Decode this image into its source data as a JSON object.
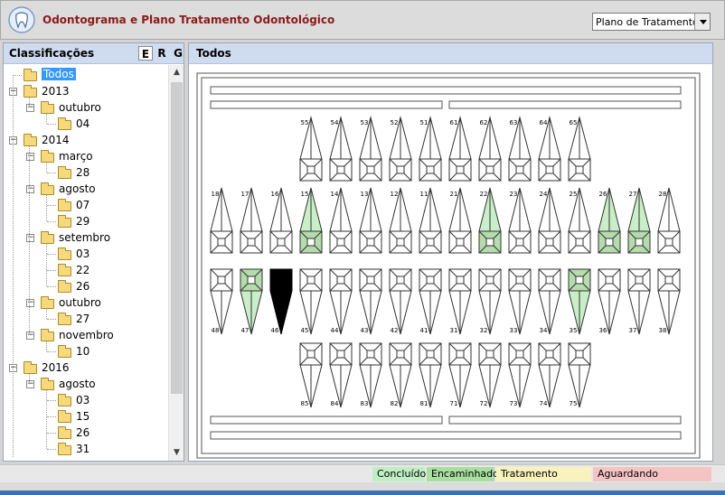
{
  "header": {
    "title": "Odontograma e Plano Tratamento Odontológico",
    "mode_select": {
      "value": "Plano de Tratamento"
    }
  },
  "left_panel": {
    "title": "Classificações",
    "buttons": [
      "E",
      "R",
      "G"
    ]
  },
  "tree": [
    {
      "label": "Todos",
      "level": 0,
      "selected": true,
      "expander": ""
    },
    {
      "label": "2013",
      "level": 0,
      "expander": "−"
    },
    {
      "label": "outubro",
      "level": 1,
      "expander": "−"
    },
    {
      "label": "04",
      "level": 2,
      "expander": ""
    },
    {
      "label": "2014",
      "level": 0,
      "expander": "−"
    },
    {
      "label": "março",
      "level": 1,
      "expander": "−"
    },
    {
      "label": "28",
      "level": 2,
      "expander": ""
    },
    {
      "label": "agosto",
      "level": 1,
      "expander": "−"
    },
    {
      "label": "07",
      "level": 2,
      "expander": ""
    },
    {
      "label": "29",
      "level": 2,
      "expander": ""
    },
    {
      "label": "setembro",
      "level": 1,
      "expander": "−"
    },
    {
      "label": "03",
      "level": 2,
      "expander": ""
    },
    {
      "label": "22",
      "level": 2,
      "expander": ""
    },
    {
      "label": "26",
      "level": 2,
      "expander": ""
    },
    {
      "label": "outubro",
      "level": 1,
      "expander": "−"
    },
    {
      "label": "27",
      "level": 2,
      "expander": ""
    },
    {
      "label": "novembro",
      "level": 1,
      "expander": "−"
    },
    {
      "label": "10",
      "level": 2,
      "expander": ""
    },
    {
      "label": "2016",
      "level": 0,
      "expander": "−"
    },
    {
      "label": "agosto",
      "level": 1,
      "expander": "−"
    },
    {
      "label": "03",
      "level": 2,
      "expander": ""
    },
    {
      "label": "15",
      "level": 2,
      "expander": ""
    },
    {
      "label": "26",
      "level": 2,
      "expander": ""
    },
    {
      "label": "31",
      "level": 2,
      "expander": ""
    }
  ],
  "right_panel": {
    "title": "Todos"
  },
  "colors": {
    "concluido": "#bfeec4",
    "encaminhado": "#a8dfa0",
    "interno": "#f8f3bc",
    "aguardando": "#f4c4c4",
    "root_green": "#c8efc8",
    "crown_green": "#b4dcac",
    "extracted": "#000000"
  },
  "odontogram": {
    "upper_primary": [
      {
        "n": "55",
        "state": "normal"
      },
      {
        "n": "54",
        "state": "normal"
      },
      {
        "n": "53",
        "state": "normal"
      },
      {
        "n": "52",
        "state": "normal"
      },
      {
        "n": "51",
        "state": "normal"
      },
      {
        "n": "61",
        "state": "normal"
      },
      {
        "n": "62",
        "state": "normal"
      },
      {
        "n": "63",
        "state": "normal"
      },
      {
        "n": "64",
        "state": "normal"
      },
      {
        "n": "65",
        "state": "normal"
      }
    ],
    "upper_permanent": [
      {
        "n": "18",
        "state": "normal"
      },
      {
        "n": "17",
        "state": "normal"
      },
      {
        "n": "16",
        "state": "normal"
      },
      {
        "n": "15",
        "state": "green"
      },
      {
        "n": "14",
        "state": "normal"
      },
      {
        "n": "13",
        "state": "normal"
      },
      {
        "n": "12",
        "state": "normal"
      },
      {
        "n": "11",
        "state": "normal"
      },
      {
        "n": "21",
        "state": "normal"
      },
      {
        "n": "22",
        "state": "green"
      },
      {
        "n": "23",
        "state": "normal"
      },
      {
        "n": "24",
        "state": "normal"
      },
      {
        "n": "25",
        "state": "normal"
      },
      {
        "n": "26",
        "state": "green"
      },
      {
        "n": "27",
        "state": "green"
      },
      {
        "n": "28",
        "state": "normal"
      }
    ],
    "lower_permanent": [
      {
        "n": "48",
        "state": "normal"
      },
      {
        "n": "47",
        "state": "green"
      },
      {
        "n": "46",
        "state": "extracted"
      },
      {
        "n": "45",
        "state": "normal"
      },
      {
        "n": "44",
        "state": "normal"
      },
      {
        "n": "43",
        "state": "normal"
      },
      {
        "n": "42",
        "state": "normal"
      },
      {
        "n": "41",
        "state": "normal"
      },
      {
        "n": "31",
        "state": "normal"
      },
      {
        "n": "32",
        "state": "normal"
      },
      {
        "n": "33",
        "state": "normal"
      },
      {
        "n": "34",
        "state": "normal"
      },
      {
        "n": "35",
        "state": "green"
      },
      {
        "n": "36",
        "state": "normal"
      },
      {
        "n": "37",
        "state": "normal"
      },
      {
        "n": "38",
        "state": "normal"
      }
    ],
    "lower_primary": [
      {
        "n": "85",
        "state": "normal"
      },
      {
        "n": "84",
        "state": "normal"
      },
      {
        "n": "83",
        "state": "normal"
      },
      {
        "n": "82",
        "state": "normal"
      },
      {
        "n": "81",
        "state": "normal"
      },
      {
        "n": "71",
        "state": "normal"
      },
      {
        "n": "72",
        "state": "normal"
      },
      {
        "n": "73",
        "state": "normal"
      },
      {
        "n": "74",
        "state": "normal"
      },
      {
        "n": "75",
        "state": "normal"
      }
    ]
  },
  "legend": {
    "concluido": "Concluído",
    "encaminhado": "Encaminhado",
    "interno": "Tratamento Interno",
    "aguardando": "Aguardando Tratamento"
  }
}
